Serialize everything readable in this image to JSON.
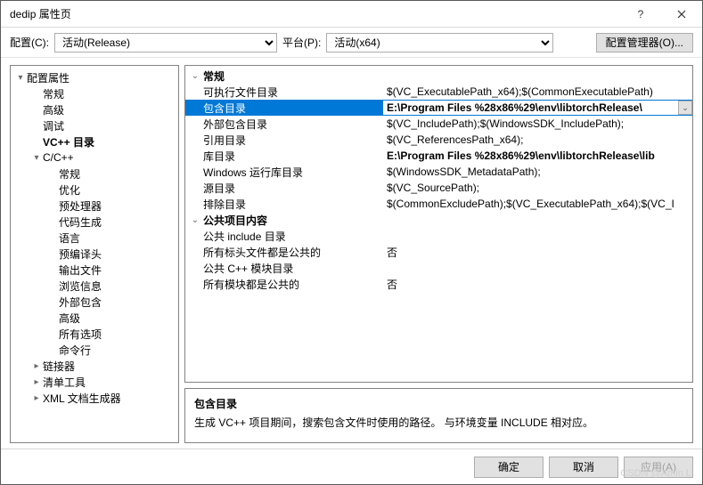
{
  "window": {
    "title": "dedip 属性页"
  },
  "toolbar": {
    "config_label": "配置(C):",
    "config_value": "活动(Release)",
    "platform_label": "平台(P):",
    "platform_value": "活动(x64)",
    "manager_label": "配置管理器(O)..."
  },
  "tree": [
    {
      "label": "配置属性",
      "depth": 0,
      "exp": "▾",
      "bold": false
    },
    {
      "label": "常规",
      "depth": 1,
      "exp": "",
      "bold": false
    },
    {
      "label": "高级",
      "depth": 1,
      "exp": "",
      "bold": false
    },
    {
      "label": "调试",
      "depth": 1,
      "exp": "",
      "bold": false
    },
    {
      "label": "VC++ 目录",
      "depth": 1,
      "exp": "",
      "bold": true
    },
    {
      "label": "C/C++",
      "depth": 1,
      "exp": "▾",
      "bold": false
    },
    {
      "label": "常规",
      "depth": 2,
      "exp": "",
      "bold": false
    },
    {
      "label": "优化",
      "depth": 2,
      "exp": "",
      "bold": false
    },
    {
      "label": "预处理器",
      "depth": 2,
      "exp": "",
      "bold": false
    },
    {
      "label": "代码生成",
      "depth": 2,
      "exp": "",
      "bold": false
    },
    {
      "label": "语言",
      "depth": 2,
      "exp": "",
      "bold": false
    },
    {
      "label": "预编译头",
      "depth": 2,
      "exp": "",
      "bold": false
    },
    {
      "label": "输出文件",
      "depth": 2,
      "exp": "",
      "bold": false
    },
    {
      "label": "浏览信息",
      "depth": 2,
      "exp": "",
      "bold": false
    },
    {
      "label": "外部包含",
      "depth": 2,
      "exp": "",
      "bold": false
    },
    {
      "label": "高级",
      "depth": 2,
      "exp": "",
      "bold": false
    },
    {
      "label": "所有选项",
      "depth": 2,
      "exp": "",
      "bold": false
    },
    {
      "label": "命令行",
      "depth": 2,
      "exp": "",
      "bold": false
    },
    {
      "label": "链接器",
      "depth": 1,
      "exp": "▸",
      "bold": false
    },
    {
      "label": "清单工具",
      "depth": 1,
      "exp": "▸",
      "bold": false
    },
    {
      "label": "XML 文档生成器",
      "depth": 1,
      "exp": "▸",
      "bold": false
    }
  ],
  "grid": {
    "sections": [
      {
        "header": "常规",
        "rows": [
          {
            "label": "可执行文件目录",
            "value": "$(VC_ExecutablePath_x64);$(CommonExecutablePath)",
            "sel": false,
            "bold": false
          },
          {
            "label": "包含目录",
            "value": "E:\\Program Files %28x86%29\\env\\libtorchRelease\\",
            "sel": true,
            "bold": true
          },
          {
            "label": "外部包含目录",
            "value": "$(VC_IncludePath);$(WindowsSDK_IncludePath);",
            "sel": false,
            "bold": false
          },
          {
            "label": "引用目录",
            "value": "$(VC_ReferencesPath_x64);",
            "sel": false,
            "bold": false
          },
          {
            "label": "库目录",
            "value": "E:\\Program Files %28x86%29\\env\\libtorchRelease\\lib",
            "sel": false,
            "bold": true
          },
          {
            "label": "Windows 运行库目录",
            "value": "$(WindowsSDK_MetadataPath);",
            "sel": false,
            "bold": false
          },
          {
            "label": "源目录",
            "value": "$(VC_SourcePath);",
            "sel": false,
            "bold": false
          },
          {
            "label": "排除目录",
            "value": "$(CommonExcludePath);$(VC_ExecutablePath_x64);$(VC_I",
            "sel": false,
            "bold": false
          }
        ]
      },
      {
        "header": "公共项目内容",
        "rows": [
          {
            "label": "公共 include 目录",
            "value": "",
            "sel": false,
            "bold": false
          },
          {
            "label": "所有标头文件都是公共的",
            "value": "否",
            "sel": false,
            "bold": false
          },
          {
            "label": "公共 C++ 模块目录",
            "value": "",
            "sel": false,
            "bold": false
          },
          {
            "label": "所有模块都是公共的",
            "value": "否",
            "sel": false,
            "bold": false
          }
        ]
      }
    ]
  },
  "description": {
    "title": "包含目录",
    "body": "生成 VC++ 项目期间，搜索包含文件时使用的路径。  与环境变量 INCLUDE 相对应。"
  },
  "footer": {
    "ok": "确定",
    "cancel": "取消",
    "apply": "应用(A)"
  },
  "watermark": "CSDN @Amin L"
}
